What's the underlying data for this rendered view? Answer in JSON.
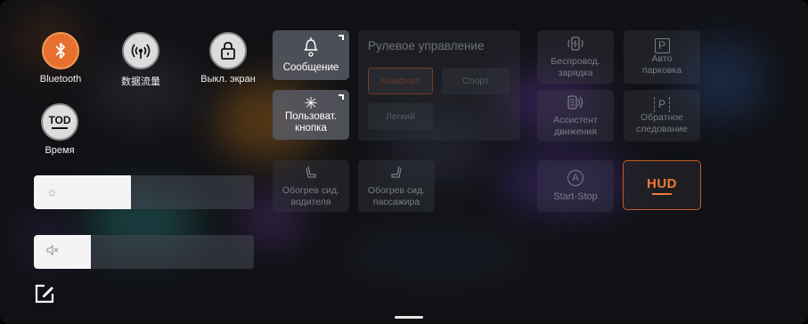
{
  "quick_controls": [
    {
      "label": "Bluetooth",
      "icon": "bluetooth-icon",
      "active": true
    },
    {
      "label": "数据流量",
      "icon": "data-traffic-icon",
      "active": false
    },
    {
      "label": "Выкл. экран",
      "icon": "screen-lock-icon",
      "active": false
    },
    {
      "label": "Время",
      "icon": "tod-icon",
      "icon_text": "TOD",
      "active": false
    }
  ],
  "sliders": {
    "brightness": {
      "icon": "brightness-icon",
      "level_percent": 44
    },
    "volume": {
      "icon": "mute-icon",
      "level_percent": 26
    }
  },
  "tiles": {
    "message": {
      "label": "Сообщение",
      "icon": "bell-icon"
    },
    "custom_button": {
      "label_line1": "Пользоват.",
      "label_line2": "кнопка",
      "icon": "asterisk-icon"
    },
    "steering": {
      "title": "Рулевое управление",
      "modes": [
        "Комфорт",
        "Спорт",
        "Легкий"
      ],
      "selected": "Комфорт"
    },
    "wireless_charging": {
      "label_line1": "Беспровод.",
      "label_line2": "зарядка",
      "icon": "wireless-charging-icon"
    },
    "auto_parking": {
      "label_line1": "Авто",
      "label_line2": "парковка",
      "icon": "parking-icon",
      "icon_text": "P"
    },
    "driving_assistant": {
      "label_line1": "Ассистент",
      "label_line2": "движения",
      "icon": "assistant-icon"
    },
    "reverse_follow": {
      "label_line1": "Обратное",
      "label_line2": "следование",
      "icon": "reverse-parking-icon",
      "icon_text": "P"
    },
    "driver_seat_heat": {
      "label_line1": "Обогрев сид.",
      "label_line2": "водителя",
      "icon": "seat-heat-driver-icon"
    },
    "passenger_seat_heat": {
      "label_line1": "Обогрев сид.",
      "label_line2": "пассажира",
      "icon": "seat-heat-passenger-icon"
    },
    "start_stop": {
      "label": "Start-Stop",
      "icon": "start-stop-icon",
      "icon_text": "A"
    },
    "hud": {
      "label": "HUD",
      "active": true
    }
  },
  "edit": {
    "icon": "edit-icon"
  },
  "colors": {
    "accent": "#e8702e",
    "hud": "#f07a36"
  }
}
